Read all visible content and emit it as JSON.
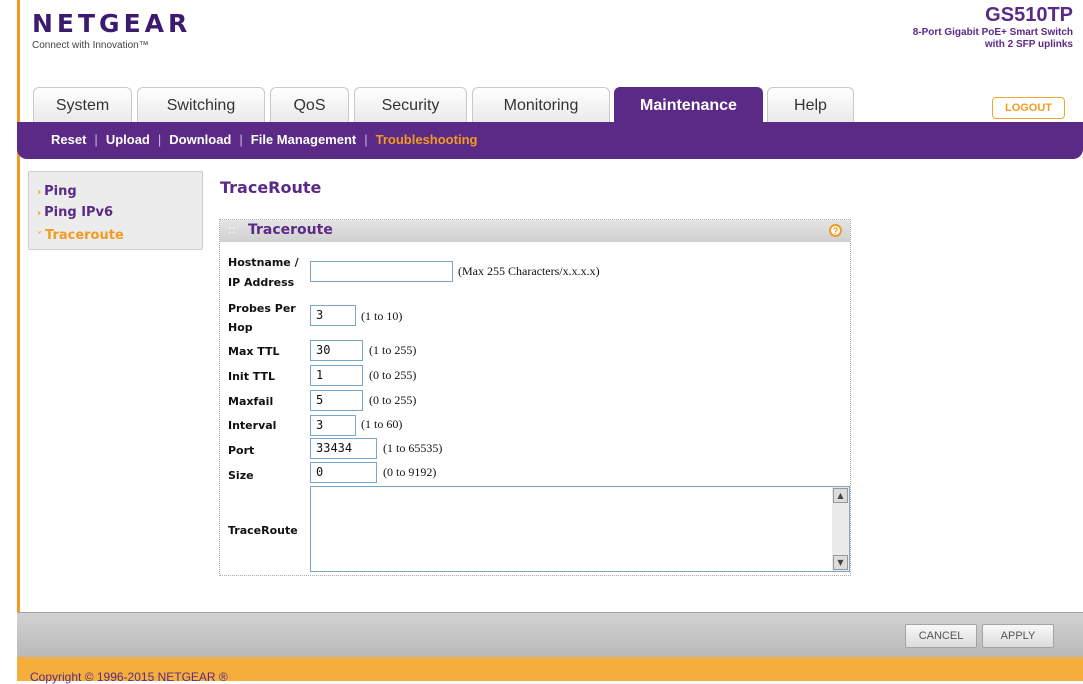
{
  "header": {
    "logo": "NETGEAR",
    "tagline": "Connect with Innovation™",
    "model": "GS510TP",
    "model_desc_1": "8-Port Gigabit PoE+ Smart Switch",
    "model_desc_2": "with 2 SFP uplinks",
    "logout": "LOGOUT"
  },
  "tabs": [
    {
      "label": "System"
    },
    {
      "label": "Switching"
    },
    {
      "label": "QoS"
    },
    {
      "label": "Security"
    },
    {
      "label": "Monitoring"
    },
    {
      "label": "Maintenance",
      "active": true
    },
    {
      "label": "Help"
    }
  ],
  "subnav": [
    {
      "label": "Reset"
    },
    {
      "label": "Upload"
    },
    {
      "label": "Download"
    },
    {
      "label": "File Management"
    },
    {
      "label": "Troubleshooting",
      "active": true
    }
  ],
  "leftmenu": [
    {
      "label": "Ping"
    },
    {
      "label": "Ping IPv6"
    },
    {
      "label": "Traceroute",
      "active": true
    }
  ],
  "page_title": "TraceRoute",
  "panel": {
    "title": "Traceroute",
    "help": "?",
    "fields": {
      "hostname": {
        "label1": "Hostname /",
        "label2": "IP Address",
        "value": "",
        "hint": "(Max 255 Characters/x.x.x.x)"
      },
      "probes": {
        "label1": "Probes Per",
        "label2": "Hop",
        "value": "3",
        "hint": "(1 to 10)"
      },
      "maxttl": {
        "label": "Max TTL",
        "value": "30",
        "hint": "(1 to 255)"
      },
      "initttl": {
        "label": "Init TTL",
        "value": "1",
        "hint": "(0 to 255)"
      },
      "maxfail": {
        "label": "Maxfail",
        "value": "5",
        "hint": "(0 to 255)"
      },
      "interval": {
        "label": "Interval",
        "value": "3",
        "hint": "(1 to 60)"
      },
      "port": {
        "label": "Port",
        "value": "33434",
        "hint": "(1 to 65535)"
      },
      "size": {
        "label": "Size",
        "value": "0",
        "hint": "(0 to 9192)"
      },
      "traceroute": {
        "label": "TraceRoute",
        "value": ""
      }
    }
  },
  "buttons": {
    "cancel": "CANCEL",
    "apply": "APPLY"
  },
  "copyright": "Copyright © 1996-2015 NETGEAR ®",
  "colors": {
    "brand_purple": "#5b2a86",
    "accent_orange": "#f29b21"
  }
}
